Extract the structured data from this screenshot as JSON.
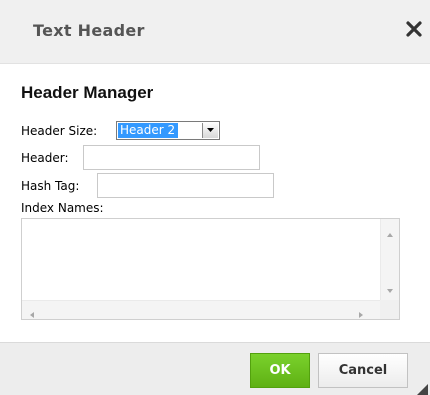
{
  "dialog": {
    "title": "Text Header",
    "close_icon": "close-icon"
  },
  "form": {
    "heading": "Header Manager",
    "header_size_label": "Header Size:",
    "header_size_value": "Header 2",
    "header_label": "Header:",
    "header_value": "",
    "hash_tag_label": "Hash Tag:",
    "hash_tag_value": "",
    "index_names_label": "Index Names:",
    "index_names_value": ""
  },
  "footer": {
    "ok_label": "OK",
    "cancel_label": "Cancel"
  },
  "colors": {
    "ok_button": "#66bb1a",
    "selection": "#3399ff",
    "titlebar": "#f0f0f0",
    "footer": "#ededed"
  }
}
